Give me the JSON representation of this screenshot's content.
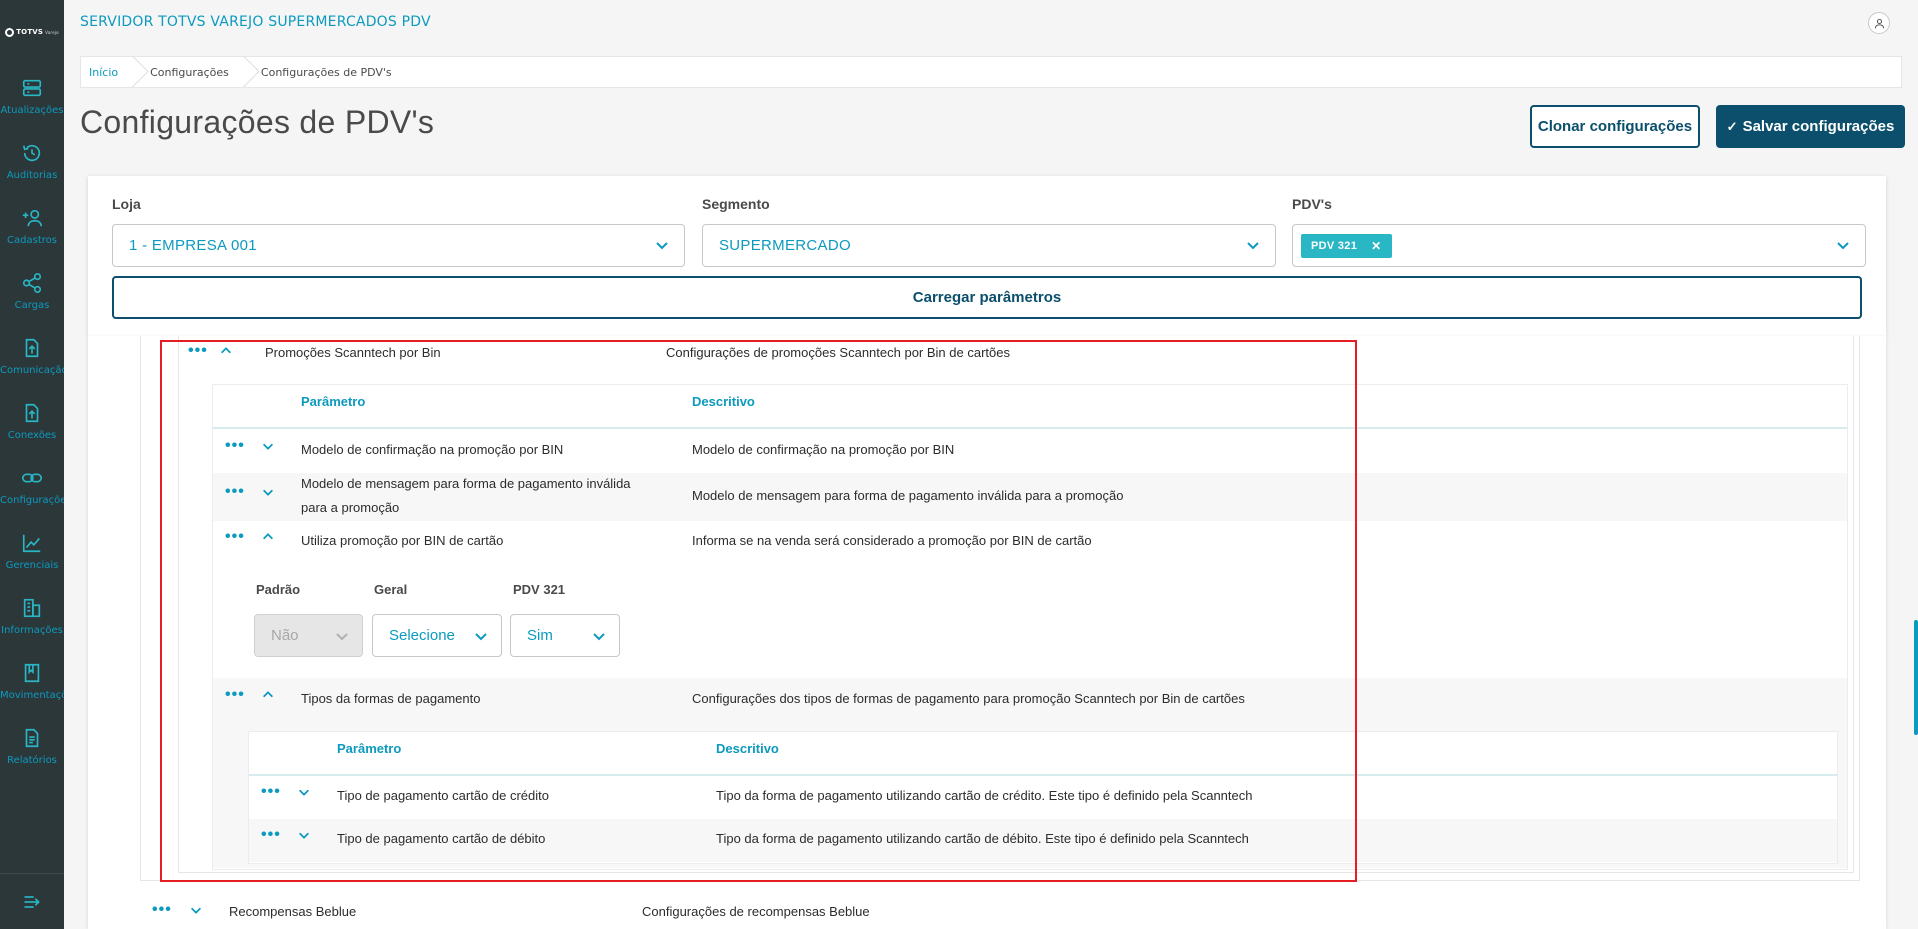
{
  "app": {
    "logo_text": "TOTVS",
    "logo_sub": "Varejo",
    "title": "SERVIDOR TOTVS VAREJO SUPERMERCADOS PDV"
  },
  "sidebar": {
    "items": [
      {
        "label": "Atualizações",
        "icon": "server-icon"
      },
      {
        "label": "Auditorias",
        "icon": "history-icon"
      },
      {
        "label": "Cadastros",
        "icon": "add-user-icon"
      },
      {
        "label": "Cargas",
        "icon": "share-icon"
      },
      {
        "label": "Comunicação",
        "icon": "upload-doc-icon"
      },
      {
        "label": "Conexões",
        "icon": "upload-doc-icon"
      },
      {
        "label": "Configurações",
        "icon": "link-icon"
      },
      {
        "label": "Gerenciais",
        "icon": "chart-icon"
      },
      {
        "label": "Informações",
        "icon": "building-icon"
      },
      {
        "label": "Movimentações",
        "icon": "book-icon"
      },
      {
        "label": "Relatórios",
        "icon": "document-icon"
      }
    ]
  },
  "breadcrumb": [
    "Início",
    "Configurações",
    "Configurações de PDV's"
  ],
  "page": {
    "title": "Configurações de PDV's",
    "clone_label": "Clonar configurações",
    "save_label": "Salvar configurações"
  },
  "filters": {
    "loja_label": "Loja",
    "loja_value": "1 - EMPRESA 001",
    "segmento_label": "Segmento",
    "segmento_value": "SUPERMERCADO",
    "pdvs_label": "PDV's",
    "pdv_tag": "PDV 321",
    "load_label": "Carregar parâmetros"
  },
  "group": {
    "name": "Promoções Scanntech por Bin",
    "description": "Configurações de promoções Scanntech por Bin de cartões",
    "col_param": "Parâmetro",
    "col_desc": "Descritivo",
    "rows": [
      {
        "param": "Modelo de confirmação na promoção por BIN",
        "desc": "Modelo de confirmação na promoção por BIN"
      },
      {
        "param_line1": "Modelo de mensagem para forma de pagamento inválida",
        "param_line2": "para a promoção",
        "desc": "Modelo de mensagem para forma de pagamento inválida para a promoção"
      },
      {
        "param": "Utiliza promoção por BIN de cartão",
        "desc": "Informa se na venda será considerado a promoção por BIN de cartão"
      }
    ],
    "values": {
      "padrao_label": "Padrão",
      "padrao_value": "Não",
      "geral_label": "Geral",
      "geral_value": "Selecione",
      "pdv_label": "PDV 321",
      "pdv_value": "Sim"
    },
    "subgroup": {
      "name": "Tipos da formas de pagamento",
      "description": "Configurações dos tipos de formas de pagamento para promoção Scanntech por Bin de cartões",
      "col_param": "Parâmetro",
      "col_desc": "Descritivo",
      "rows": [
        {
          "param": "Tipo de pagamento cartão de crédito",
          "desc": "Tipo da forma de pagamento utilizando cartão de crédito. Este tipo é definido pela Scanntech"
        },
        {
          "param": "Tipo de pagamento cartão de débito",
          "desc": "Tipo da forma de pagamento utilizando cartão de débito. Este tipo é definido pela Scanntech"
        }
      ]
    }
  },
  "next_group": {
    "name": "Recompensas Beblue",
    "description": "Configurações de recompensas Beblue"
  },
  "colors": {
    "sidebar_bg": "#2c3739",
    "accent": "#0c9abe",
    "primary": "#0b4f6c",
    "tag": "#29b6c5",
    "highlight": "#e51c23"
  }
}
